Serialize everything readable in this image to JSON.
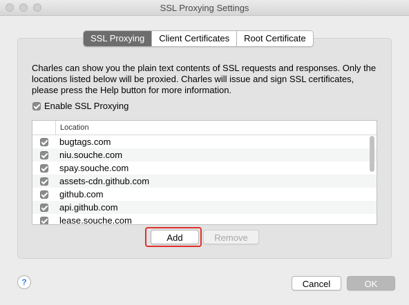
{
  "window": {
    "title": "SSL Proxying Settings"
  },
  "tabs": [
    {
      "label": "SSL Proxying",
      "active": true
    },
    {
      "label": "Client Certificates",
      "active": false
    },
    {
      "label": "Root Certificate",
      "active": false
    }
  ],
  "description": "Charles can show you the plain text contents of SSL requests and responses. Only the locations listed below will be proxied. Charles will issue and sign SSL certificates, please press the Help button for more information.",
  "enable_ssl": {
    "label": "Enable SSL Proxying",
    "checked": true
  },
  "table": {
    "column_header": "Location",
    "rows": [
      {
        "location": "bugtags.com",
        "checked": true
      },
      {
        "location": "niu.souche.com",
        "checked": true
      },
      {
        "location": "spay.souche.com",
        "checked": true
      },
      {
        "location": "assets-cdn.github.com",
        "checked": true
      },
      {
        "location": "github.com",
        "checked": true
      },
      {
        "location": "api.github.com",
        "checked": true
      },
      {
        "location": "lease.souche.com",
        "checked": true
      }
    ]
  },
  "buttons": {
    "add": "Add",
    "remove": "Remove",
    "help": "?",
    "cancel": "Cancel",
    "ok": "OK"
  },
  "colors": {
    "highlight": "#e0302a",
    "active_tab": "#6d6d6d"
  }
}
